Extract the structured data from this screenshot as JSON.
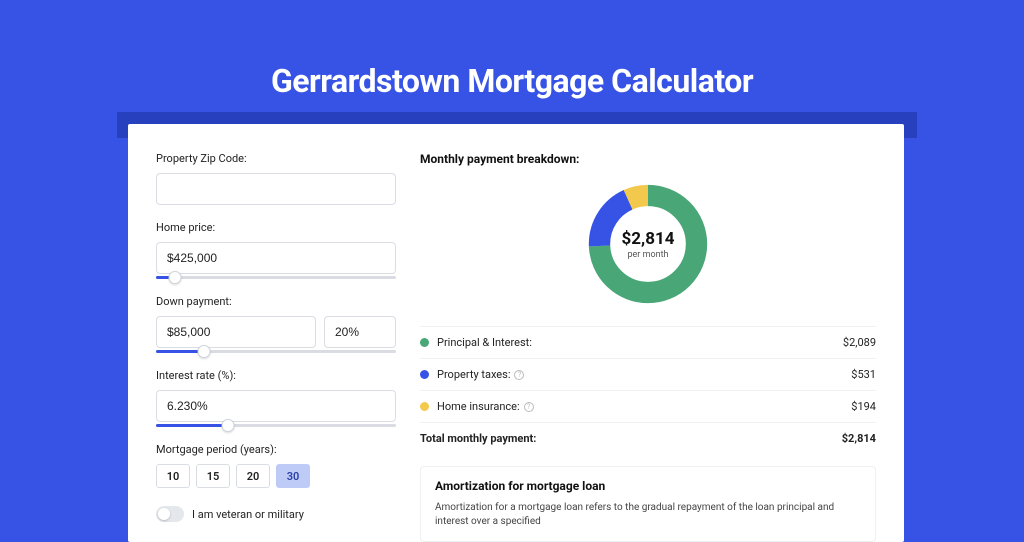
{
  "page_title": "Gerrardstown Mortgage Calculator",
  "colors": {
    "principal": "#49a677",
    "taxes": "#3653e6",
    "insurance": "#f2c94c"
  },
  "form": {
    "zip": {
      "label": "Property Zip Code:",
      "value": ""
    },
    "home_price": {
      "label": "Home price:",
      "value": "$425,000",
      "slider_pct": 8
    },
    "down_payment": {
      "label": "Down payment:",
      "amount": "$85,000",
      "percent": "20%",
      "slider_pct": 20
    },
    "interest_rate": {
      "label": "Interest rate (%):",
      "value": "6.230%",
      "slider_pct": 30
    },
    "mortgage_period": {
      "label": "Mortgage period (years):",
      "options": [
        "10",
        "15",
        "20",
        "30"
      ],
      "selected": "30"
    },
    "veteran": {
      "label": "I am veteran or military",
      "on": false
    }
  },
  "breakdown": {
    "title": "Monthly payment breakdown:",
    "total_amount": "$2,814",
    "total_caption": "per month",
    "items": [
      {
        "key": "principal",
        "label": "Principal & Interest:",
        "value": "$2,089",
        "info": false
      },
      {
        "key": "taxes",
        "label": "Property taxes:",
        "value": "$531",
        "info": true
      },
      {
        "key": "insurance",
        "label": "Home insurance:",
        "value": "$194",
        "info": true
      }
    ],
    "total_row": {
      "label": "Total monthly payment:",
      "value": "$2,814"
    }
  },
  "amortization": {
    "title": "Amortization for mortgage loan",
    "text": "Amortization for a mortgage loan refers to the gradual repayment of the loan principal and interest over a specified"
  },
  "chart_data": {
    "type": "pie",
    "title": "Monthly payment breakdown",
    "series": [
      {
        "name": "Principal & Interest",
        "value": 2089,
        "color": "#49a677"
      },
      {
        "name": "Property taxes",
        "value": 531,
        "color": "#3653e6"
      },
      {
        "name": "Home insurance",
        "value": 194,
        "color": "#f2c94c"
      }
    ],
    "total": 2814,
    "center_label": "$2,814",
    "center_sub": "per month"
  }
}
